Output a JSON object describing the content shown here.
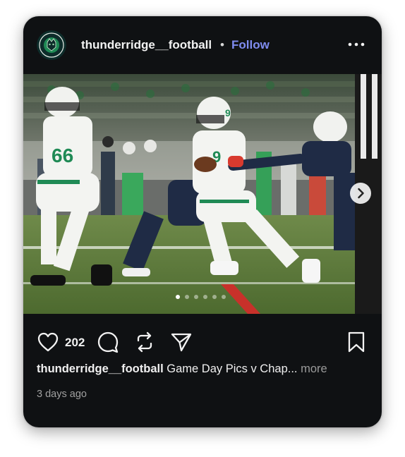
{
  "post": {
    "username": "thunderridge__football",
    "separator": "•",
    "follow_label": "Follow",
    "more_menu_icon": "more-horizontal-icon",
    "image_alt": "Football players running during a game",
    "carousel": {
      "total": 6,
      "current": 1
    },
    "likes": "202",
    "caption": {
      "username": "thunderridge__football",
      "text": "Game Day Pics v Chap...",
      "more_label": "more"
    },
    "timestamp": "3 days ago"
  },
  "icons": {
    "like": "heart-icon",
    "comment": "comment-icon",
    "repost": "repost-icon",
    "share": "send-icon",
    "save": "bookmark-icon",
    "next": "chevron-right-icon"
  },
  "colors": {
    "card_bg": "#0f1113",
    "follow": "#7f8cf0",
    "team_green": "#1f8a55"
  }
}
